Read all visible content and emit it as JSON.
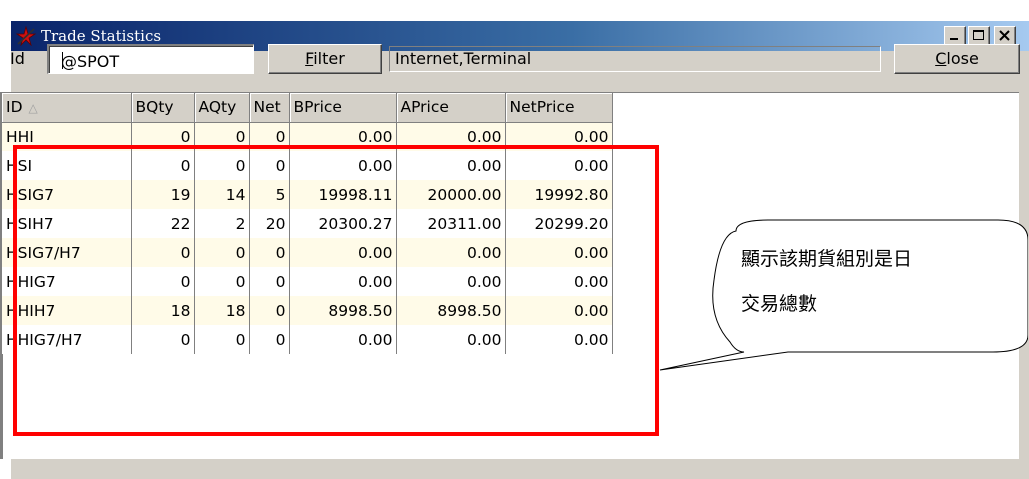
{
  "window": {
    "title": "Trade Statistics",
    "icon": "red-star-app-icon",
    "controls": [
      "minimize-icon",
      "maximize-icon",
      "close-icon"
    ]
  },
  "toolbar": {
    "id_label": "Id",
    "id_value": "@SPOT",
    "filter_label": "Filter",
    "filter_mnemonic": "F",
    "filter_rest": "ilter",
    "source_text": "Internet,Terminal",
    "close_label": "Close",
    "close_mnemonic": "C",
    "close_rest": "lose"
  },
  "table": {
    "columns": [
      "ID",
      "BQty",
      "AQty",
      "Net",
      "BPrice",
      "APrice",
      "NetPrice"
    ],
    "sort_indicator": "△",
    "rows": [
      {
        "id": "HHI",
        "bqty": "0",
        "aqty": "0",
        "net": "0",
        "bprice": "0.00",
        "aprice": "0.00",
        "netprice": "0.00"
      },
      {
        "id": "HSI",
        "bqty": "0",
        "aqty": "0",
        "net": "0",
        "bprice": "0.00",
        "aprice": "0.00",
        "netprice": "0.00"
      },
      {
        "id": "HSIG7",
        "bqty": "19",
        "aqty": "14",
        "net": "5",
        "bprice": "19998.11",
        "aprice": "20000.00",
        "netprice": "19992.80"
      },
      {
        "id": "HSIH7",
        "bqty": "22",
        "aqty": "2",
        "net": "20",
        "bprice": "20300.27",
        "aprice": "20311.00",
        "netprice": "20299.20"
      },
      {
        "id": "HSIG7/H7",
        "bqty": "0",
        "aqty": "0",
        "net": "0",
        "bprice": "0.00",
        "aprice": "0.00",
        "netprice": "0.00"
      },
      {
        "id": "HHIG7",
        "bqty": "0",
        "aqty": "0",
        "net": "0",
        "bprice": "0.00",
        "aprice": "0.00",
        "netprice": "0.00"
      },
      {
        "id": "HHIH7",
        "bqty": "18",
        "aqty": "18",
        "net": "0",
        "bprice": "8998.50",
        "aprice": "8998.50",
        "netprice": "0.00"
      },
      {
        "id": "HHIG7/H7",
        "bqty": "0",
        "aqty": "0",
        "net": "0",
        "bprice": "0.00",
        "aprice": "0.00",
        "netprice": "0.00"
      }
    ]
  },
  "annotation": {
    "line1": "顯示該期貨組別是日",
    "line2": "交易總數",
    "highlight_color": "#ff0000"
  },
  "colors": {
    "titlebar_start": "#0a246a",
    "titlebar_end": "#a6caf0",
    "face": "#d4d0c8",
    "row_tint": "#fffbe8"
  }
}
